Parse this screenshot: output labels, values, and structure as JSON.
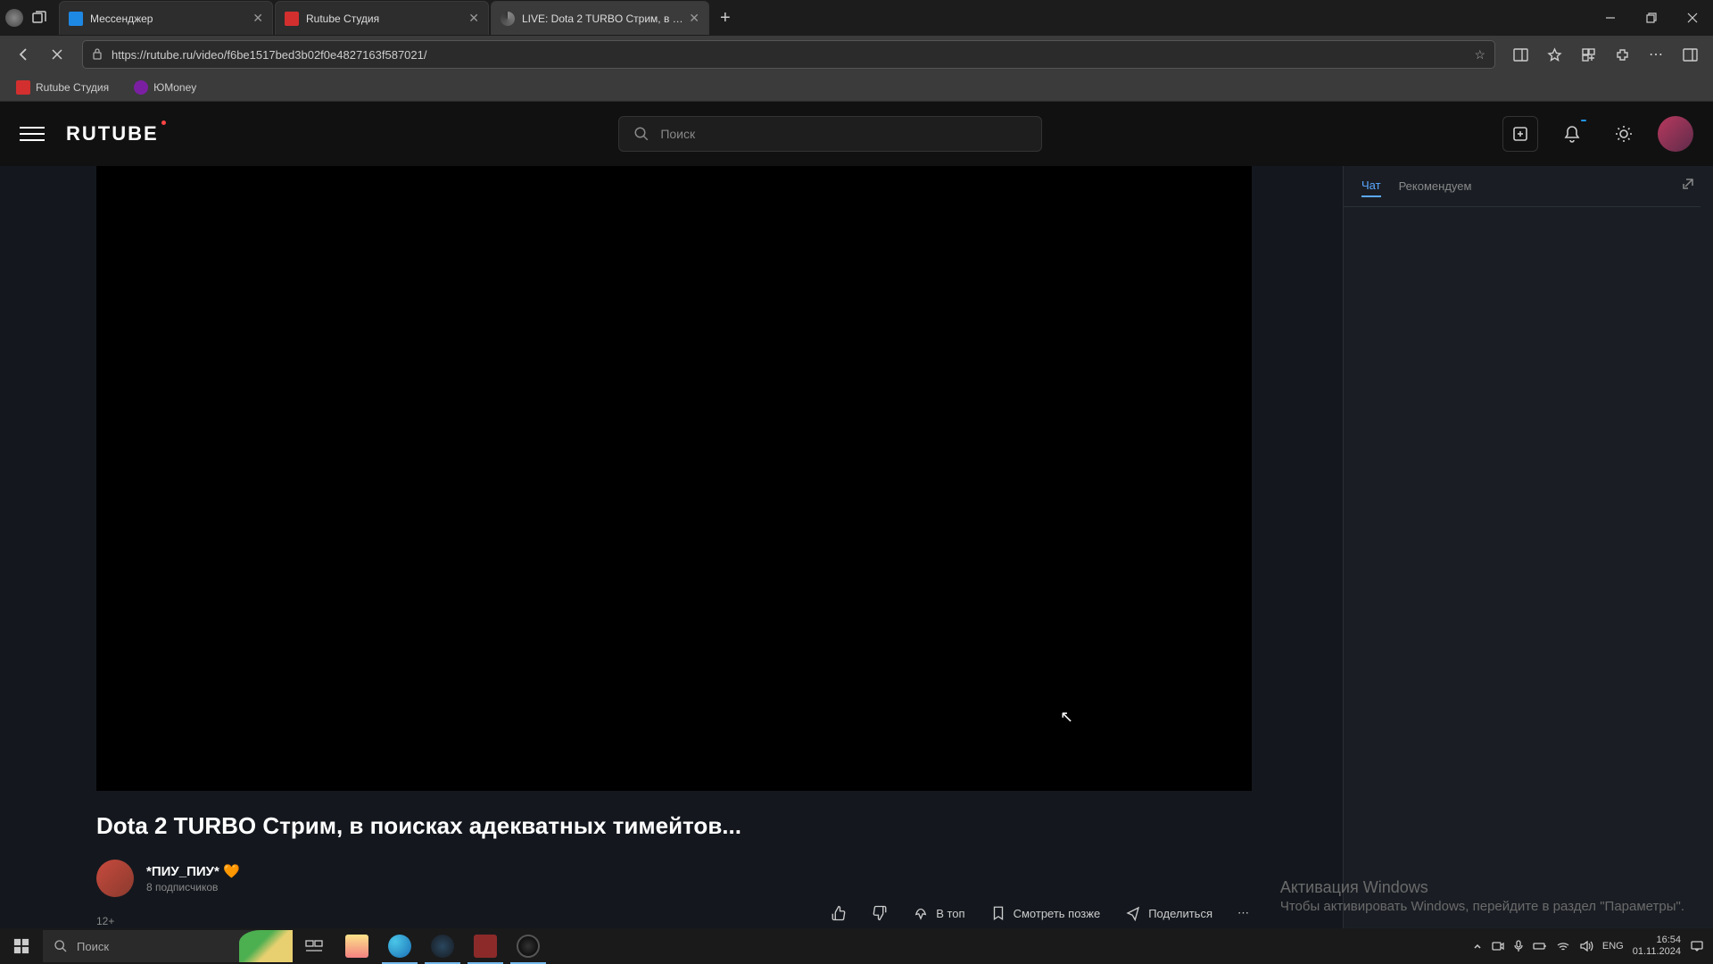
{
  "browser": {
    "tabs": [
      {
        "title": "Мессенджер"
      },
      {
        "title": "Rutube Студия"
      },
      {
        "title": "LIVE: Dota 2 TURBO Стрим, в по"
      }
    ],
    "url": "https://rutube.ru/video/f6be1517bed3b02f0e4827163f587021/"
  },
  "bookmarks": [
    {
      "label": "Rutube Студия"
    },
    {
      "label": "ЮMoney"
    }
  ],
  "header": {
    "logo": "RUTUBE",
    "search_placeholder": "Поиск"
  },
  "video": {
    "title": "Dota 2 TURBO Стрим, в поисках адекватных тимейтов...",
    "age": "12+"
  },
  "channel": {
    "name": "*ПИУ_ПИУ* 🧡",
    "subs": "8 подписчиков"
  },
  "actions": {
    "top": "В топ",
    "later": "Смотреть позже",
    "share": "Поделиться"
  },
  "side": {
    "chat": "Чат",
    "recommend": "Рекомендуем"
  },
  "activation": {
    "title": "Активация Windows",
    "text": "Чтобы активировать Windows, перейдите в раздел \"Параметры\"."
  },
  "taskbar": {
    "search_placeholder": "Поиск",
    "lang": "ENG",
    "time": "16:54",
    "date": "01.11.2024"
  }
}
